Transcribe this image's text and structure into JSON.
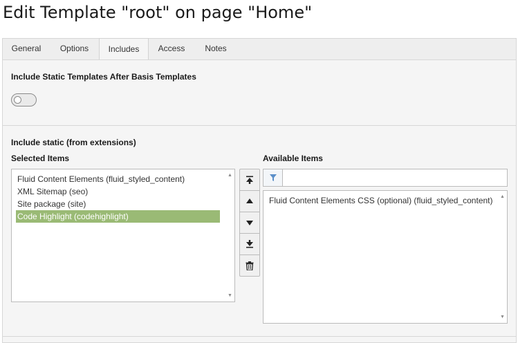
{
  "page": {
    "title": "Edit Template \"root\" on page \"Home\""
  },
  "tabs": [
    {
      "label": "General",
      "active": false
    },
    {
      "label": "Options",
      "active": false
    },
    {
      "label": "Includes",
      "active": true
    },
    {
      "label": "Access",
      "active": false
    },
    {
      "label": "Notes",
      "active": false
    }
  ],
  "static_after_basis": {
    "label": "Include Static Templates After Basis Templates",
    "enabled": false
  },
  "include_static": {
    "heading": "Include static (from extensions)",
    "selected_label": "Selected Items",
    "available_label": "Available Items",
    "selected_items": [
      {
        "label": "Fluid Content Elements (fluid_styled_content)",
        "selected": false
      },
      {
        "label": "XML Sitemap (seo)",
        "selected": false
      },
      {
        "label": "Site package (site)",
        "selected": false
      },
      {
        "label": "Code Highlight (codehighlight)",
        "selected": true
      }
    ],
    "available_items": [
      {
        "label": "Fluid Content Elements CSS (optional) (fluid_styled_content)"
      }
    ],
    "filter": {
      "value": "",
      "placeholder": ""
    }
  },
  "icons": {
    "move_top": "move-to-top-icon",
    "move_up": "move-up-icon",
    "move_down": "move-down-icon",
    "move_bottom": "move-to-bottom-icon",
    "remove": "trash-icon",
    "filter": "filter-icon"
  },
  "colors": {
    "selected_item_bg": "#9aba75",
    "panel_bg": "#f5f5f5",
    "filter_icon": "#5b8fc9"
  }
}
